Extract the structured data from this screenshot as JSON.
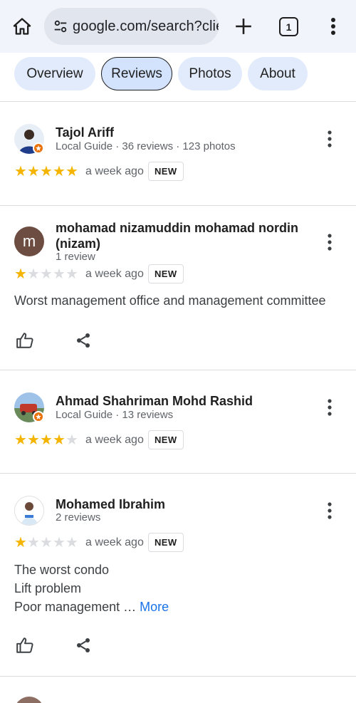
{
  "browser": {
    "url": "google.com/search?clie",
    "tab_count": "1"
  },
  "tabs": [
    {
      "label": "Overview",
      "active": false
    },
    {
      "label": "Reviews",
      "active": true
    },
    {
      "label": "Photos",
      "active": false
    },
    {
      "label": "About",
      "active": false
    }
  ],
  "reviews": [
    {
      "name": "Tajol Ariff",
      "meta": "Local Guide · 36 reviews · 123 photos",
      "rating": 5,
      "time": "a week ago",
      "badge": "NEW"
    },
    {
      "name_line1": "mohamad nizamuddin mohamad nordin",
      "name_line2": "(nizam)",
      "avatar_letter": "m",
      "meta": "1 review",
      "rating": 1,
      "time": "a week ago",
      "badge": "NEW",
      "text": "Worst management office and management committee"
    },
    {
      "name": "Ahmad Shahriman Mohd Rashid",
      "meta": "Local Guide · 13 reviews",
      "rating": 4,
      "time": "a week ago",
      "badge": "NEW"
    },
    {
      "name": "Mohamed Ibrahim",
      "meta": "2 reviews",
      "rating": 1,
      "time": "a week ago",
      "badge": "NEW",
      "text_lines": [
        "The worst condo",
        "Lift problem",
        "Poor management …"
      ],
      "more": "More"
    }
  ],
  "colors": {
    "star_on": "#f4b400",
    "star_off": "#dadce0",
    "chip_bg": "#e2ebfb",
    "link": "#1a73e8",
    "local_guide_badge": "#e8710a"
  }
}
